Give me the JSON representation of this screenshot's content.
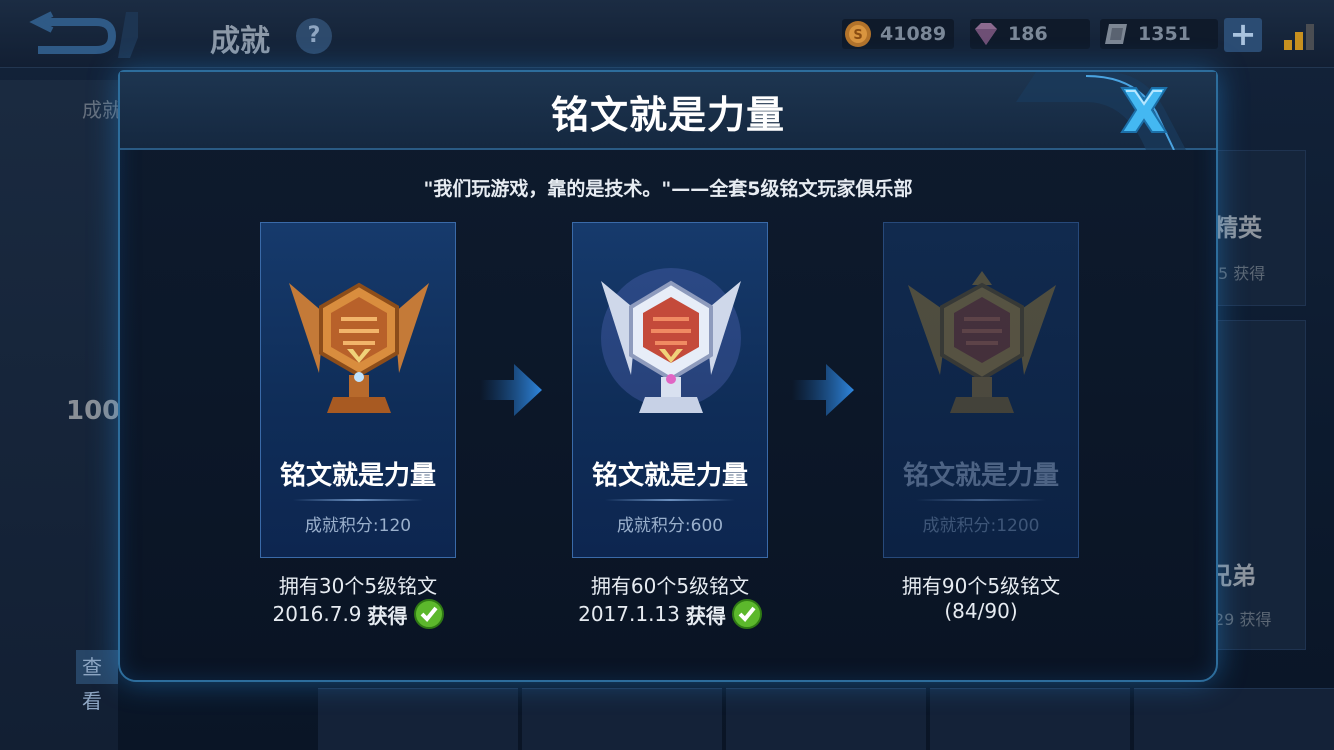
{
  "topbar": {
    "title": "成就",
    "help_icon": "?",
    "currencies": [
      {
        "icon": "gold-coin-icon",
        "value": "41089"
      },
      {
        "icon": "diamond-icon",
        "value": "186"
      },
      {
        "icon": "voucher-icon",
        "value": "1351"
      }
    ],
    "plus_label": "+"
  },
  "background": {
    "left_label": "成就",
    "left_score": "100",
    "left_view_button": "查看",
    "right_title_1": "精英",
    "right_sub_1": "5 获得",
    "right_title_2": "兄弟",
    "right_sub_2": "29 获得"
  },
  "modal": {
    "title": "铭文就是力量",
    "quote": "\"我们玩游戏，靠的是技术。\"——全套5级铭文玩家俱乐部",
    "tiers": [
      {
        "name": "铭文就是力量",
        "points": "成就积分:120",
        "requirement": "拥有30个5级铭文",
        "date": "2016.7.9",
        "status": "获得",
        "medal": "bronze",
        "achieved": true
      },
      {
        "name": "铭文就是力量",
        "points": "成就积分:600",
        "requirement": "拥有60个5级铭文",
        "date": "2017.1.13",
        "status": "获得",
        "medal": "silver",
        "achieved": true
      },
      {
        "name": "铭文就是力量",
        "points": "成就积分:1200",
        "requirement": "拥有90个5级铭文",
        "progress": "(84/90)",
        "medal": "gold",
        "achieved": false
      }
    ]
  },
  "colors": {
    "accent": "#2d6d9c",
    "check_green": "#5cb82c",
    "close_blue": "#3aa8e8"
  }
}
